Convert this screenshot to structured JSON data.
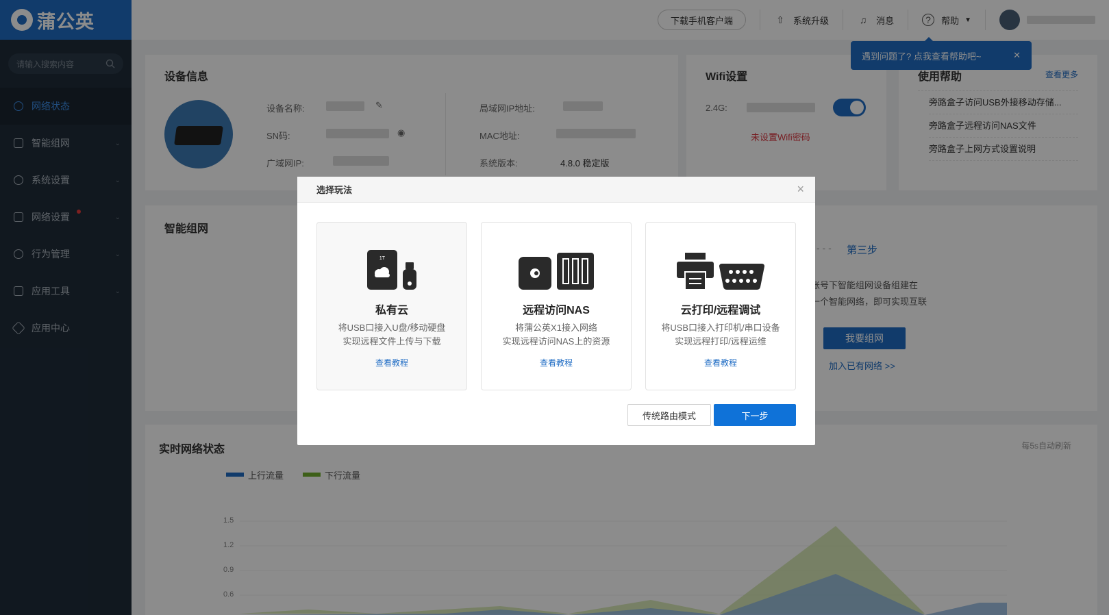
{
  "brand": {
    "name": "蒲公英"
  },
  "sidebar": {
    "search_placeholder": "请输入搜索内容",
    "items": [
      {
        "label": "网络状态",
        "active": true
      },
      {
        "label": "智能组网"
      },
      {
        "label": "系统设置"
      },
      {
        "label": "网络设置",
        "dot": true
      },
      {
        "label": "行为管理"
      },
      {
        "label": "应用工具"
      },
      {
        "label": "应用中心"
      }
    ]
  },
  "topbar": {
    "download_label": "下载手机客户端",
    "upgrade_label": "系统升级",
    "messages_label": "消息",
    "help_label": "帮助"
  },
  "tooltip": {
    "text": "遇到问题了? 点我查看帮助吧~",
    "close": "✕"
  },
  "device_info": {
    "title": "设备信息",
    "name_label": "设备名称:",
    "sn_label": "SN码:",
    "wan_label": "广域网IP:",
    "lan_label": "局域网IP地址:",
    "mac_label": "MAC地址:",
    "version_label": "系统版本:",
    "version_value": "4.8.0 稳定版"
  },
  "wifi": {
    "title": "Wifi设置",
    "band_label": "2.4G:",
    "warning": "未设置Wifi密码",
    "enabled": true
  },
  "help": {
    "title": "使用帮助",
    "more": "查看更多",
    "items": [
      "旁路盒子访问USB外接移动存储...",
      "旁路盒子远程访问NAS文件",
      "旁路盒子上网方式设置说明"
    ]
  },
  "smart_network": {
    "title": "智能组网",
    "step3": "第三步",
    "desc_line1": "账号下智能组网设备组建在",
    "desc_line2": "一个智能网络，即可实现互联",
    "join_button": "我要组网",
    "join_existing": "加入已有网络 >>"
  },
  "realtime": {
    "title": "实时网络状态",
    "refresh_note": "每5s自动刷新",
    "legend_up": "上行流量",
    "legend_down": "下行流量",
    "yticks": [
      "1.5",
      "1.2",
      "0.9",
      "0.6"
    ],
    "up_color": "#1f6cc4",
    "down_color": "#6fae2c"
  },
  "modal": {
    "title": "选择玩法",
    "close": "×",
    "options": [
      {
        "title": "私有云",
        "desc1": "将USB口接入U盘/移动硬盘",
        "desc2": "实现远程文件上传与下载",
        "link": "查看教程",
        "icon_badge": "1T"
      },
      {
        "title": "远程访问NAS",
        "desc1": "将蒲公英X1接入网络",
        "desc2": "实现远程访问NAS上的资源",
        "link": "查看教程"
      },
      {
        "title": "云打印/远程调试",
        "desc1": "将USB口接入打印机/串口设备",
        "desc2": "实现远程打印/远程运维",
        "link": "查看教程"
      }
    ],
    "secondary_button": "传统路由模式",
    "primary_button": "下一步"
  }
}
